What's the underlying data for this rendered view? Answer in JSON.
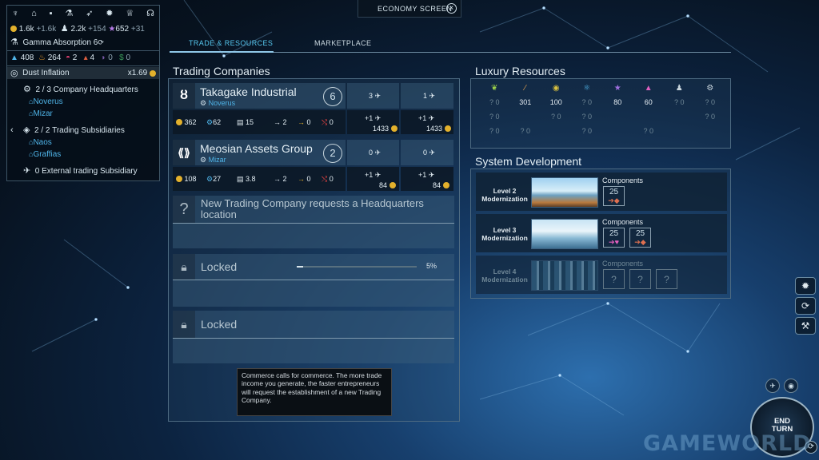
{
  "top": {
    "screen_title": "ECONOMY SCREEN",
    "close_icon": "×"
  },
  "tabs": [
    {
      "label": "TRADE & RESOURCES",
      "active": true
    },
    {
      "label": "MARKETPLACE",
      "active": false
    }
  ],
  "resources": {
    "dust": "1.6k",
    "dust_rate": "+1.6k",
    "food": "2.2k",
    "food_rate": "+154",
    "influence": "652",
    "influence_rate": "+31"
  },
  "tech": {
    "name": "Gamma Absorption 6"
  },
  "strategic": [
    "408",
    "264",
    "2",
    "4",
    "0",
    "0"
  ],
  "dust_inflation": {
    "label": "Dust Inflation",
    "value": "x1.69"
  },
  "hq": {
    "summary": "2 / 3 Company Headquarters",
    "systems": [
      "Noverus",
      "Mizar"
    ],
    "subsidiaries": "2 / 2 Trading Subsidiaries",
    "sub_systems": [
      "Naos",
      "Graffias"
    ],
    "external": "0 External trading Subsidiary"
  },
  "trading": {
    "title": "Trading Companies",
    "companies": [
      {
        "name": "Takagake Industrial",
        "hq": "Noverus",
        "level": "6",
        "dust": "362",
        "science": "62",
        "fleet": "15",
        "arrow_a": "2",
        "arrow_b": "0",
        "arrow_c": "0",
        "col1_top": "3",
        "col2_top": "1",
        "col1_plus": "+1",
        "col2_plus": "+1",
        "col1_cost": "1433",
        "col2_cost": "1433"
      },
      {
        "name": "Meosian Assets Group",
        "hq": "Mizar",
        "level": "2",
        "dust": "108",
        "science": "27",
        "fleet": "3.8",
        "arrow_a": "2",
        "arrow_b": "0",
        "arrow_c": "0",
        "col1_top": "0",
        "col2_top": "0",
        "col1_plus": "+1",
        "col2_plus": "+1",
        "col1_cost": "84",
        "col2_cost": "84"
      }
    ],
    "request": {
      "q": "?",
      "text": "New Trading Company requests a Headquarters location"
    },
    "locked": [
      {
        "label": "Locked",
        "progress_label": "5%",
        "progress": 0.05
      },
      {
        "label": "Locked"
      }
    ]
  },
  "luxury": {
    "title": "Luxury Resources",
    "icons": [
      "sprout",
      "feather",
      "sun",
      "molecule",
      "star",
      "thumb",
      "people",
      "gear"
    ],
    "rows": [
      [
        "?0",
        "301",
        "100",
        "?0",
        "80",
        "60",
        "?0",
        "?0"
      ],
      [
        "?0",
        "",
        "?0",
        "?0",
        "",
        "",
        "",
        "?0"
      ],
      [
        "?0",
        "?0",
        "",
        "?0",
        "",
        "?0",
        "",
        ""
      ]
    ]
  },
  "system_dev": {
    "title": "System Development",
    "levels": [
      {
        "label": "Level 2 Modernization",
        "components": "Components",
        "slots": [
          {
            "count": "25"
          }
        ]
      },
      {
        "label": "Level 3 Modernization",
        "components": "Components",
        "slots": [
          {
            "count": "25"
          },
          {
            "count": "25"
          }
        ]
      },
      {
        "label": "Level 4 Modernization",
        "components": "Components",
        "slots": [
          {
            "count": "?"
          },
          {
            "count": "?"
          },
          {
            "count": "?"
          }
        ]
      }
    ]
  },
  "tooltip": {
    "text": "Commerce calls for commerce. The more trade income you generate, the faster entrepreneurs will request the establishment of a new Trading Company."
  },
  "end_turn": {
    "label": "END TURN"
  },
  "watermark": "GAMEWORLD",
  "colors": {
    "accent_blue": "#4fb4e8",
    "dust_gold": "#e3b12c",
    "panel_border": "#4e6b82"
  }
}
